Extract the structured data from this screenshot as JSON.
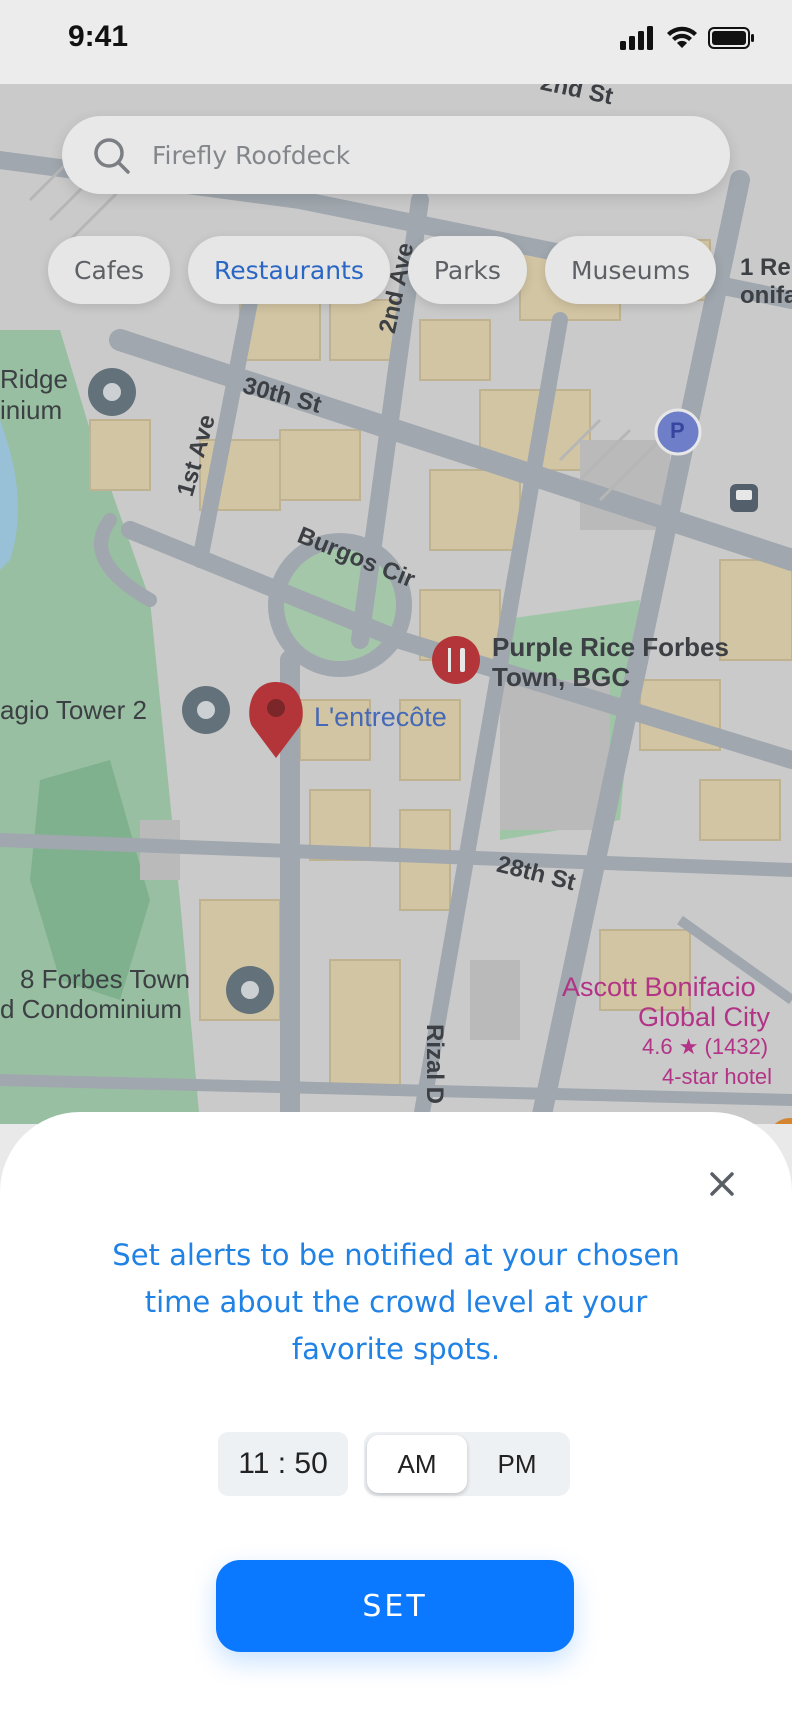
{
  "status_bar": {
    "time": "9:41"
  },
  "search": {
    "placeholder": "Firefly Roofdeck"
  },
  "categories": [
    "Cafes",
    "Restaurants",
    "Parks",
    "Museums"
  ],
  "active_category": "Restaurants",
  "map": {
    "streets": {
      "s2nd_st": "2nd St",
      "s30th_st": "30th St",
      "s2nd_ave": "2nd Ave",
      "s1st_ave": "1st Ave",
      "burgos_cir": "Burgos Cir",
      "s28th_st": "28th St",
      "rizal_dr": "Rizal D"
    },
    "places": {
      "ridge_a": "Ridge",
      "ridge_b": "inium",
      "agio": "agio Tower 2",
      "purple_a": "Purple Rice Forbes",
      "purple_b": "Town, BGC",
      "lentrecote": "L'entrecôte",
      "forbes_a": "8 Forbes Town",
      "forbes_b": "d Condominium",
      "ascott_a": "Ascott Bonifacio",
      "ascott_b": "Global City",
      "ascott_rating": "4.6 ★ (1432)",
      "ascott_type": "4-star hotel",
      "right_a": "1 Re",
      "right_b": "onifa",
      "parking": "P"
    },
    "colors": {
      "road": "#aeb6bf",
      "block": "#ead9b2",
      "park": "#8ec9a0",
      "pin_red": "#c0262b",
      "hotel_pink": "#c0248a",
      "water": "#9fd0ec"
    }
  },
  "sheet": {
    "message": "Set alerts to be notified at your chosen time about the crowd level at your favorite spots.",
    "time": "11 : 50",
    "am": "AM",
    "pm": "PM",
    "selected_period": "AM",
    "set_label": "SET",
    "accent": "#0a79ff"
  }
}
